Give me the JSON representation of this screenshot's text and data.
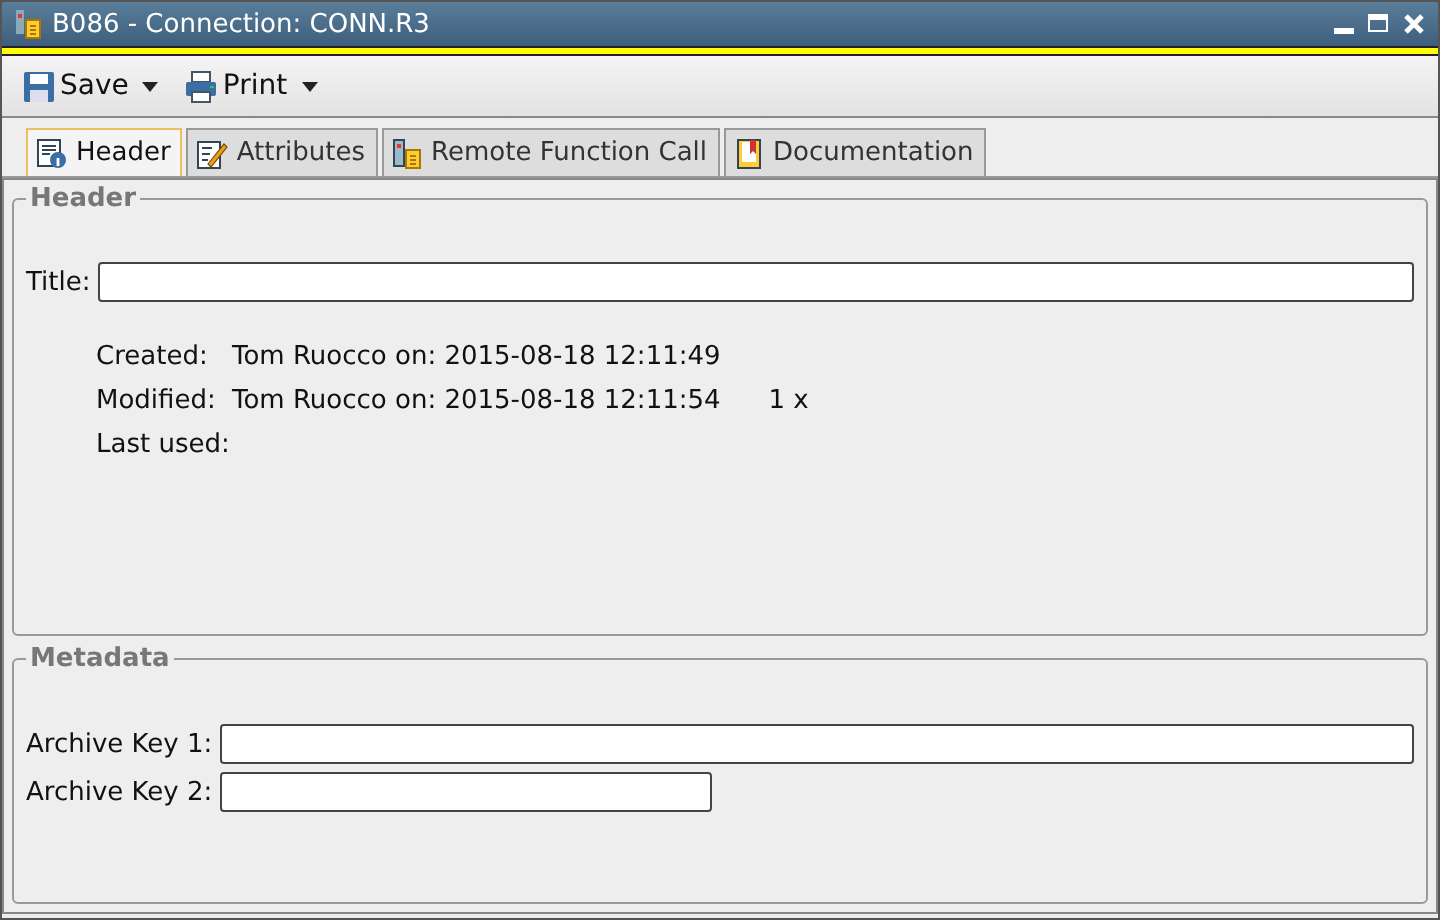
{
  "window": {
    "title": "B086 - Connection: CONN.R3"
  },
  "toolbar": [
    {
      "label": "Save"
    },
    {
      "label": "Print"
    }
  ],
  "tabs": [
    {
      "label": "Header",
      "selected": true
    },
    {
      "label": "Attributes",
      "selected": false
    },
    {
      "label": "Remote Function Call",
      "selected": false
    },
    {
      "label": "Documentation",
      "selected": false
    }
  ],
  "header": {
    "legend": "Header",
    "title_label": "Title:",
    "info": [
      {
        "label": "Created:",
        "value": "Tom Ruocco on: 2015-08-18 12:11:49"
      },
      {
        "label": "Modified:",
        "value": "Tom Ruocco on: 2015-08-18 12:11:54",
        "count": "1 x"
      },
      {
        "label": "Last used:"
      }
    ]
  },
  "metadata": {
    "legend": "Metadata",
    "fields": [
      {
        "label": "Archive Key 1:"
      },
      {
        "label": "Archive Key 2:"
      }
    ]
  }
}
